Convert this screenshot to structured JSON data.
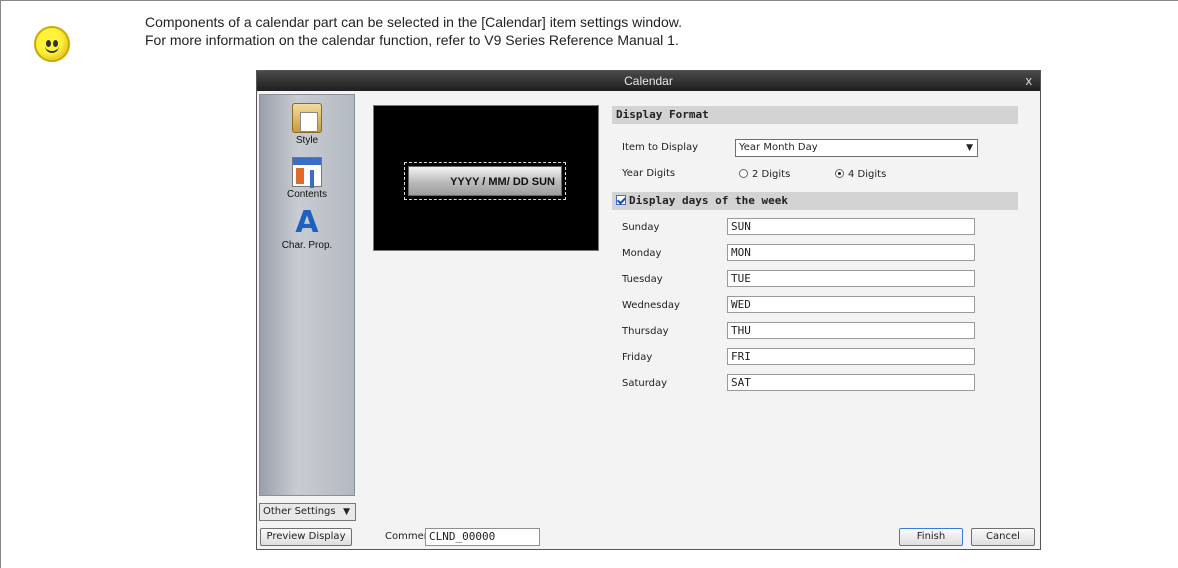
{
  "note": {
    "line1": "Components of a calendar part can be selected in the [Calendar] item settings window.",
    "line2": "For more information on the calendar function, refer to V9 Series Reference Manual 1."
  },
  "dialog": {
    "title": "Calendar",
    "close_glyph": "x",
    "sidebar": {
      "items": [
        {
          "label": "Style",
          "icon": "style-icon"
        },
        {
          "label": "Contents",
          "icon": "contents-icon"
        },
        {
          "label": "Char. Prop.",
          "icon": "char-prop-icon"
        }
      ]
    },
    "preview_text": "YYYY / MM/ DD SUN",
    "display_format": {
      "header": "Display Format",
      "item_to_display_label": "Item to Display",
      "item_to_display_value": "Year Month Day",
      "year_digits_label": "Year Digits",
      "year_digits_options": [
        "2 Digits",
        "4 Digits"
      ],
      "year_digits_selected": "4 Digits"
    },
    "week_days": {
      "header": "Display days of the week",
      "checked": true,
      "rows": [
        {
          "label": "Sunday",
          "value": "SUN"
        },
        {
          "label": "Monday",
          "value": "MON"
        },
        {
          "label": "Tuesday",
          "value": "TUE"
        },
        {
          "label": "Wednesday",
          "value": "WED"
        },
        {
          "label": "Thursday",
          "value": "THU"
        },
        {
          "label": "Friday",
          "value": "FRI"
        },
        {
          "label": "Saturday",
          "value": "SAT"
        }
      ]
    },
    "other_settings_label": "Other Settings",
    "preview_display_label": "Preview Display",
    "comment_label": "Comment",
    "comment_value": "CLND_00000",
    "finish_label": "Finish",
    "cancel_label": "Cancel"
  }
}
